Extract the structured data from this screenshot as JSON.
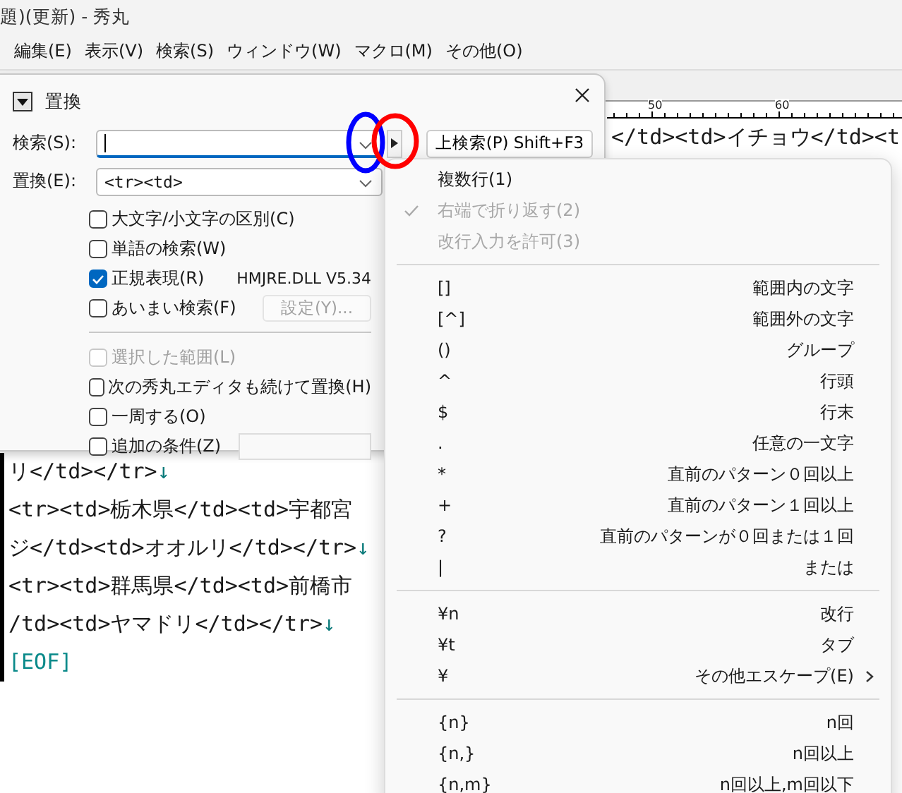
{
  "window": {
    "title": "題)(更新) - 秀丸"
  },
  "menu_bar": [
    "編集(E)",
    "表示(V)",
    "検索(S)",
    "ウィンドウ(W)",
    "マクロ(M)",
    "その他(O)"
  ],
  "ruler": {
    "labels": [
      "50",
      "60"
    ]
  },
  "editor": {
    "top_line": {
      "text": "</td><td>イチョウ</td><t"
    },
    "lines": [
      {
        "kind": "text",
        "text": "リ</td></tr>",
        "eol": "↓"
      },
      {
        "kind": "text",
        "text": "<tr><td>栃木県</td><td>宇都宮"
      },
      {
        "kind": "text",
        "text": "ジ</td><td>オオルリ</td></tr>",
        "eol": "↓"
      },
      {
        "kind": "text",
        "text": "<tr><td>群馬県</td><td>前橋市"
      },
      {
        "kind": "text",
        "text": "/td><td>ヤマドリ</td></tr>",
        "eol": "↓"
      },
      {
        "kind": "eof",
        "text": "[EOF]"
      }
    ]
  },
  "dialog": {
    "title": "置換",
    "search": {
      "label": "検索(S):"
    },
    "replace": {
      "label": "置換(E):",
      "value": "<tr><td>"
    },
    "find_prev_button": "上検索(P) Shift+F3",
    "options": [
      {
        "kind": "checkbox",
        "label": "大文字/小文字の区別(C)",
        "checked": false,
        "disabled": false
      },
      {
        "kind": "checkbox",
        "label": "単語の検索(W)",
        "checked": false,
        "disabled": false
      },
      {
        "kind": "checkbox_note",
        "label": "正規表現(R)",
        "checked": true,
        "disabled": false,
        "note": "HMJRE.DLL V5.34"
      },
      {
        "kind": "checkbox_button",
        "label": "あいまい検索(F)",
        "checked": false,
        "disabled": false,
        "button": {
          "label": "設定(Y)...",
          "disabled": true
        }
      },
      {
        "kind": "separator"
      },
      {
        "kind": "checkbox",
        "label": "選択した範囲(L)",
        "checked": false,
        "disabled": true
      },
      {
        "kind": "checkbox",
        "label": "次の秀丸エディタも続けて置換(H)",
        "checked": false,
        "disabled": false
      },
      {
        "kind": "checkbox",
        "label": "一周する(O)",
        "checked": false,
        "disabled": false
      },
      {
        "kind": "checkbox_field",
        "label": "追加の条件(Z)",
        "checked": false,
        "disabled": false
      }
    ]
  },
  "annotations": [
    {
      "color": "#0000ff"
    },
    {
      "color": "#ff0000"
    }
  ],
  "popup_menu": [
    {
      "kind": "item",
      "label": "複数行(1)",
      "checked": false,
      "disabled": false
    },
    {
      "kind": "item",
      "label": "右端で折り返す(2)",
      "checked": true,
      "disabled": true
    },
    {
      "kind": "item",
      "label": "改行入力を許可(3)",
      "checked": false,
      "disabled": true
    },
    {
      "kind": "separator"
    },
    {
      "kind": "pattern",
      "key": "[]",
      "label": "範囲内の文字"
    },
    {
      "kind": "pattern",
      "key": "[^]",
      "label": "範囲外の文字"
    },
    {
      "kind": "pattern",
      "key": "()",
      "label": "グループ"
    },
    {
      "kind": "pattern",
      "key": "^",
      "label": "行頭"
    },
    {
      "kind": "pattern",
      "key": "$",
      "label": "行末"
    },
    {
      "kind": "pattern",
      "key": ".",
      "label": "任意の一文字"
    },
    {
      "kind": "pattern",
      "key": "*",
      "label": "直前のパターン０回以上"
    },
    {
      "kind": "pattern",
      "key": "+",
      "label": "直前のパターン１回以上"
    },
    {
      "kind": "pattern",
      "key": "?",
      "label": "直前のパターンが０回または１回"
    },
    {
      "kind": "pattern",
      "key": "|",
      "label": "または"
    },
    {
      "kind": "separator"
    },
    {
      "kind": "pattern",
      "key": "¥n",
      "label": "改行"
    },
    {
      "kind": "pattern",
      "key": "¥t",
      "label": "タブ"
    },
    {
      "kind": "pattern",
      "key": "¥",
      "label": "その他エスケープ(E)",
      "submenu": true
    },
    {
      "kind": "separator"
    },
    {
      "kind": "pattern",
      "key": "{n}",
      "label": "n回"
    },
    {
      "kind": "pattern",
      "key": "{n,}",
      "label": "n回以上"
    },
    {
      "kind": "pattern",
      "key": "{n,m}",
      "label": "n回以上,m回以下"
    }
  ]
}
